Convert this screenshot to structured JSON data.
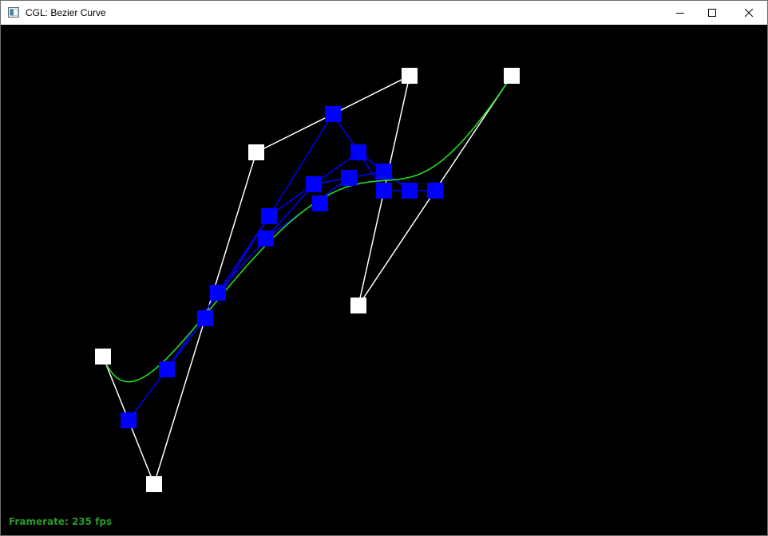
{
  "window": {
    "title": "CGL: Bezier Curve",
    "icons": {
      "app": "app-window-icon",
      "minimize": "minimize-icon",
      "maximize": "maximize-icon",
      "close": "close-icon"
    }
  },
  "status": {
    "framerate": "Framerate: 235 fps"
  },
  "colors": {
    "control_point": "#ffffff",
    "control_polygon": "#ffffff",
    "intermediate_point": "#0000ff",
    "intermediate_polygon": "#0000ff",
    "curve": "#22dd22",
    "framerate_text": "#2a9a2a",
    "background": "#000000"
  },
  "curve": {
    "control_points": [
      [
        128,
        416
      ],
      [
        192,
        576
      ],
      [
        320,
        160
      ],
      [
        512,
        64
      ],
      [
        448,
        352
      ],
      [
        640,
        64
      ]
    ],
    "intermediate_levels": [
      [
        [
          160,
          496
        ],
        [
          256,
          368
        ],
        [
          416,
          112
        ],
        [
          480,
          208
        ],
        [
          544,
          208
        ]
      ],
      [
        [
          208,
          432
        ],
        [
          336,
          240
        ],
        [
          448,
          160
        ],
        [
          512,
          208
        ]
      ],
      [
        [
          272,
          336
        ],
        [
          392,
          200
        ],
        [
          480,
          184
        ]
      ],
      [
        [
          332,
          268
        ],
        [
          436,
          192
        ]
      ],
      [
        [
          400,
          224
        ]
      ]
    ]
  }
}
